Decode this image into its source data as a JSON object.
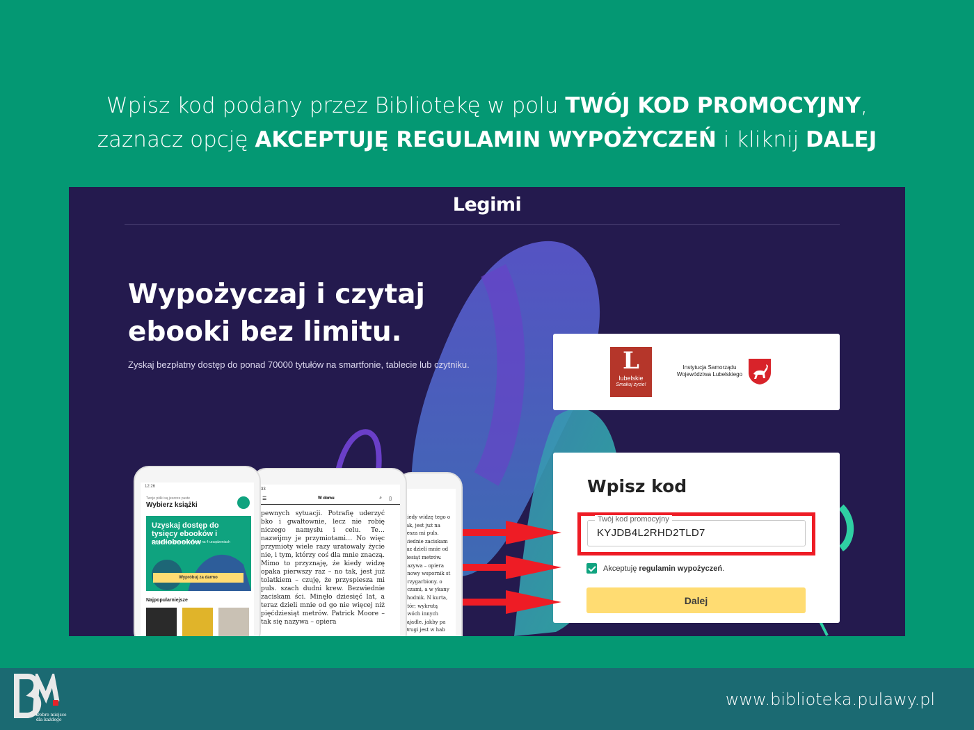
{
  "instructions": {
    "line1_prefix": "Wpisz kod podany przez Bibliotekę w polu ",
    "line1_bold": "TWÓJ KOD PROMOCYJNY",
    "line1_suffix": ",",
    "line2_prefix": "zaznacz opcję ",
    "line2_bold": "AKCEPTUJĘ REGULAMIN WYPOŻYCZEŃ",
    "line2_mid": " i kliknij ",
    "line2_bold2": "DALEJ"
  },
  "screenshot": {
    "logo": "Legimi",
    "hero_title_line1": "Wypożyczaj i czytaj",
    "hero_title_line2": "ebooki bez limitu.",
    "hero_subtitle": "Zyskaj bezpłatny dostęp do ponad 70000 tytułów na smartfonie, tablecie lub czytniku.",
    "sponsors": {
      "lubelskie_line1": "lubelskie",
      "lubelskie_line2": "Smakuj życie!",
      "institution": "Instytucja Samorządu Województwa Lubelskiego"
    },
    "code_form": {
      "title": "Wpisz kod",
      "field_label": "Twój kod promocyjny",
      "field_value": "KYJDB4L2RHD2TLD7",
      "accept_prefix": "Akceptuję",
      "accept_link": "regulamin wypożyczeń",
      "accept_suffix": ".",
      "accept_checked": true,
      "submit_label": "Dalej"
    },
    "phone1": {
      "time": "12:26",
      "small_text": "Twoje półki są jeszcze puste",
      "title": "Wybierz książki",
      "banner_title": "Uzyskaj dostęp do tysięcy ebooków i audiobooków",
      "banner_sub": "Czytaj i słuchaj bez limitu nawet na 4 urządzeniach",
      "banner_button": "Wypróbuj za darmo",
      "popular": "Najpopularniejsze"
    },
    "phone2": {
      "status": "33",
      "book_title": "W domu",
      "text": "pewnych sytuacji. Potrafię uderzyć bko i gwałtownie, lecz nie robię niczego namysłu i celu. Te… nazwijmy je przymiotami… No więc przymioty wiele razy uratowały życie nie, i tym, którzy coś dla mnie znaczą. Mimo to przyznaję, że kiedy widzę opaka pierwszy raz – no tak, jest już tolatkiem – czuję, że przyspiesza mi puls. szach dudni krew. Bezwiednie zaciskam ści. Minęło dziesięć lat, a teraz dzieli mnie od go nie więcej niż pięćdziesiąt metrów. Patrick Moore – tak się nazywa – opiera"
    },
    "phone3": {
      "text": "kiedy widzę tego o tak, jest już na zesza mi puls. wiednie zaciskam  raz dzieli mnie od ziesiąt metrów. nazywa – opiera onowy wspornik st przygarbiony. o oczami, a w ykany chodnik. N kurta, któr; wykrutą dwóch innych zajadle, jakby pa Drugi jest w hab"
    }
  },
  "footer": {
    "tagline_line1": "Dobre miejsce",
    "tagline_line2": "dla każdego",
    "url": "www.biblioteka.pulawy.pl"
  },
  "colors": {
    "background": "#049873",
    "screenshot_bg": "#241a4e",
    "footer": "#1b6a72",
    "highlight": "#ee1c25",
    "button": "#ffdc72",
    "accent": "#0fa37f"
  }
}
